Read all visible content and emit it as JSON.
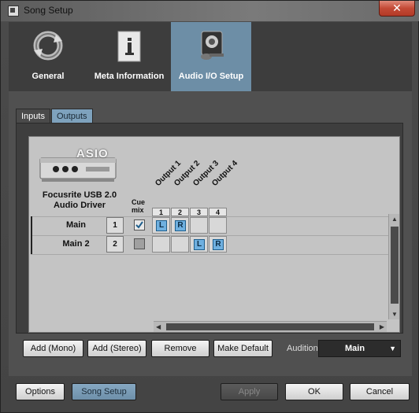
{
  "window": {
    "title": "Song Setup",
    "close_label": "✕"
  },
  "nav": {
    "items": [
      {
        "label": "General",
        "icon": "refresh-icon",
        "active": false
      },
      {
        "label": "Meta Information",
        "icon": "document-info-icon",
        "active": false
      },
      {
        "label": "Audio I/O Setup",
        "icon": "speaker-mic-icon",
        "active": true
      }
    ]
  },
  "io_tabs": [
    {
      "label": "Inputs",
      "active": false
    },
    {
      "label": "Outputs",
      "active": true
    }
  ],
  "device": {
    "logo_text": "ASIO",
    "name_line1": "Focusrite USB 2.0",
    "name_line2": "Audio Driver"
  },
  "matrix": {
    "cue_header_1": "Cue",
    "cue_header_2": "mix",
    "outputs": [
      {
        "name": "Output 1",
        "num": "1"
      },
      {
        "name": "Output 2",
        "num": "2"
      },
      {
        "name": "Output 3",
        "num": "3"
      },
      {
        "name": "Output 4",
        "num": "4"
      }
    ],
    "rows": [
      {
        "name": "Main",
        "num": "1",
        "cue_checked": true,
        "cells": [
          "L",
          "R",
          "",
          ""
        ]
      },
      {
        "name": "Main 2",
        "num": "2",
        "cue_checked": false,
        "cells": [
          "",
          "",
          "L",
          "R"
        ]
      }
    ]
  },
  "buttons": {
    "add_mono": "Add (Mono)",
    "add_stereo": "Add (Stereo)",
    "remove": "Remove",
    "make_default": "Make Default",
    "options": "Options",
    "song_setup": "Song Setup",
    "apply": "Apply",
    "ok": "OK",
    "cancel": "Cancel"
  },
  "audition": {
    "label": "Audition",
    "value": "Main"
  },
  "colors": {
    "accent": "#6d8ea6",
    "pin": "#6fb0e0",
    "close": "#c44a36"
  }
}
